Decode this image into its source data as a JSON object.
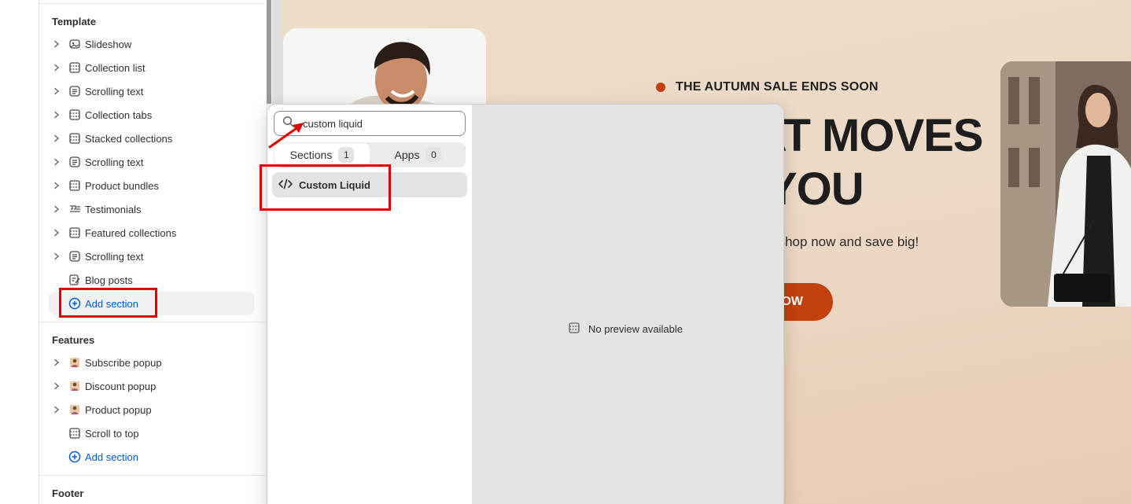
{
  "sidebar": {
    "template_title": "Template",
    "template_items": [
      {
        "label": "Slideshow",
        "icon": "slideshow-icon"
      },
      {
        "label": "Collection list",
        "icon": "section-icon"
      },
      {
        "label": "Scrolling text",
        "icon": "text-icon"
      },
      {
        "label": "Collection tabs",
        "icon": "section-icon"
      },
      {
        "label": "Stacked collections",
        "icon": "section-icon"
      },
      {
        "label": "Scrolling text",
        "icon": "text-icon"
      },
      {
        "label": "Product bundles",
        "icon": "section-icon"
      },
      {
        "label": "Testimonials",
        "icon": "quote-icon"
      },
      {
        "label": "Featured collections",
        "icon": "section-icon"
      },
      {
        "label": "Scrolling text",
        "icon": "text-icon"
      },
      {
        "label": "Blog posts",
        "icon": "blog-icon"
      }
    ],
    "template_add": "Add section",
    "features_title": "Features",
    "features_items": [
      {
        "label": "Subscribe popup",
        "icon": "popup-image-icon"
      },
      {
        "label": "Discount popup",
        "icon": "popup-image-icon"
      },
      {
        "label": "Product popup",
        "icon": "popup-image-icon"
      },
      {
        "label": "Scroll to top",
        "icon": "section-icon"
      }
    ],
    "features_add": "Add section",
    "footer_title": "Footer"
  },
  "popup": {
    "search_value": "custom liquid",
    "tabs": [
      {
        "label": "Sections",
        "count": "1"
      },
      {
        "label": "Apps",
        "count": "0"
      }
    ],
    "result_label": "Custom Liquid",
    "no_preview": "No preview available"
  },
  "hero": {
    "eyebrow": "THE AUTUMN SALE ENDS SOON",
    "headline_line1": "HAT MOVES",
    "headline_line2": "YOU",
    "subtext": "ffer. Shop now and save big!",
    "button_label": "OW"
  },
  "colors": {
    "accent": "#c2410c",
    "link": "#005bd3",
    "annotation": "#e00000"
  }
}
